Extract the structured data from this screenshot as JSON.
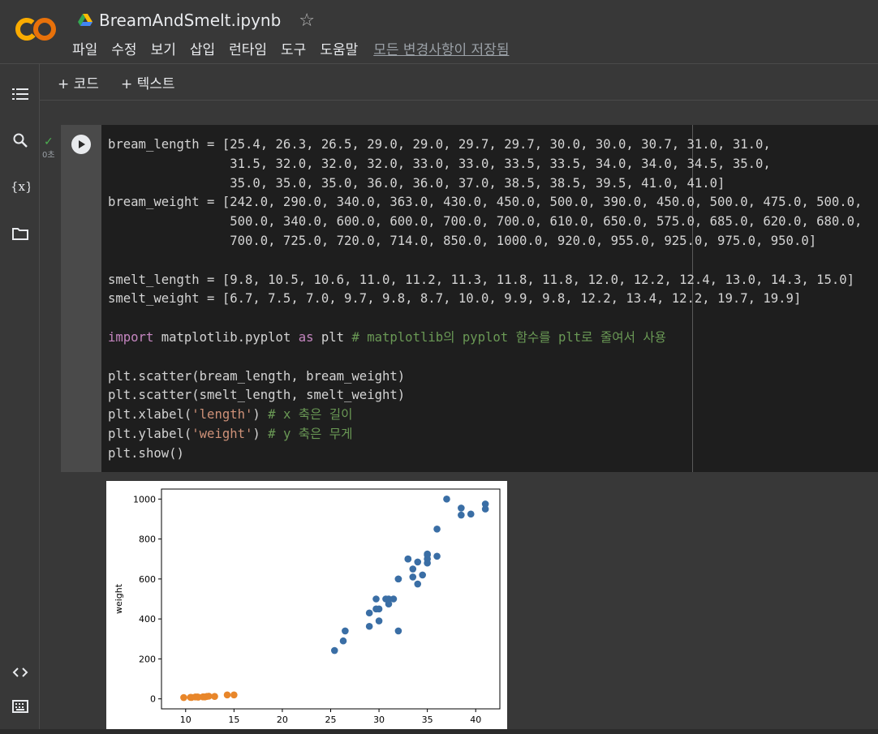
{
  "header": {
    "title": "BreamAndSmelt.ipynb",
    "menu": [
      "파일",
      "수정",
      "보기",
      "삽입",
      "런타임",
      "도구",
      "도움말"
    ],
    "save_status": "모든 변경사항이 저장됨"
  },
  "toolbar": {
    "add_code": "+ 코드",
    "add_text": "+ 텍스트"
  },
  "cell": {
    "exec_time": "0초",
    "code_lines": [
      "bream_length = [25.4, 26.3, 26.5, 29.0, 29.0, 29.7, 29.7, 30.0, 30.0, 30.7, 31.0, 31.0,",
      "                31.5, 32.0, 32.0, 32.0, 33.0, 33.0, 33.5, 33.5, 34.0, 34.0, 34.5, 35.0,",
      "                35.0, 35.0, 35.0, 36.0, 36.0, 37.0, 38.5, 38.5, 39.5, 41.0, 41.0]",
      "bream_weight = [242.0, 290.0, 340.0, 363.0, 430.0, 450.0, 500.0, 390.0, 450.0, 500.0, 475.0, 500.0,",
      "                500.0, 340.0, 600.0, 600.0, 700.0, 700.0, 610.0, 650.0, 575.0, 685.0, 620.0, 680.0,",
      "                700.0, 725.0, 720.0, 714.0, 850.0, 1000.0, 920.0, 955.0, 925.0, 975.0, 950.0]",
      "",
      "smelt_length = [9.8, 10.5, 10.6, 11.0, 11.2, 11.3, 11.8, 11.8, 12.0, 12.2, 12.4, 13.0, 14.3, 15.0]",
      "smelt_weight = [6.7, 7.5, 7.0, 9.7, 9.8, 8.7, 10.0, 9.9, 9.8, 12.2, 13.4, 12.2, 19.7, 19.9]",
      "",
      "import matplotlib.pyplot as plt # matplotlib의 pyplot 함수를 plt로 줄여서 사용",
      "",
      "plt.scatter(bream_length, bream_weight)",
      "plt.scatter(smelt_length, smelt_weight)",
      "plt.xlabel('length') # x 축은 길이",
      "plt.ylabel('weight') # y 축은 무게",
      "plt.show()"
    ]
  },
  "chart_data": {
    "type": "scatter",
    "ylabel": "weight",
    "xlim": [
      7.5,
      42.5
    ],
    "ylim": [
      -50,
      1050
    ],
    "xticks": [
      10,
      15,
      20,
      25,
      30,
      35,
      40
    ],
    "yticks": [
      0,
      200,
      400,
      600,
      800,
      1000
    ],
    "series": [
      {
        "color": "#3a6ea5",
        "x": [
          25.4,
          26.3,
          26.5,
          29.0,
          29.0,
          29.7,
          29.7,
          30.0,
          30.0,
          30.7,
          31.0,
          31.0,
          31.5,
          32.0,
          32.0,
          32.0,
          33.0,
          33.0,
          33.5,
          33.5,
          34.0,
          34.0,
          34.5,
          35.0,
          35.0,
          35.0,
          35.0,
          36.0,
          36.0,
          37.0,
          38.5,
          38.5,
          39.5,
          41.0,
          41.0
        ],
        "y": [
          242.0,
          290.0,
          340.0,
          363.0,
          430.0,
          450.0,
          500.0,
          390.0,
          450.0,
          500.0,
          475.0,
          500.0,
          500.0,
          340.0,
          600.0,
          600.0,
          700.0,
          700.0,
          610.0,
          650.0,
          575.0,
          685.0,
          620.0,
          680.0,
          700.0,
          725.0,
          720.0,
          714.0,
          850.0,
          1000.0,
          920.0,
          955.0,
          925.0,
          975.0,
          950.0
        ]
      },
      {
        "color": "#e8862a",
        "x": [
          9.8,
          10.5,
          10.6,
          11.0,
          11.2,
          11.3,
          11.8,
          11.8,
          12.0,
          12.2,
          12.4,
          13.0,
          14.3,
          15.0
        ],
        "y": [
          6.7,
          7.5,
          7.0,
          9.7,
          9.8,
          8.7,
          10.0,
          9.9,
          9.8,
          12.2,
          13.4,
          12.2,
          19.7,
          19.9
        ]
      }
    ]
  }
}
